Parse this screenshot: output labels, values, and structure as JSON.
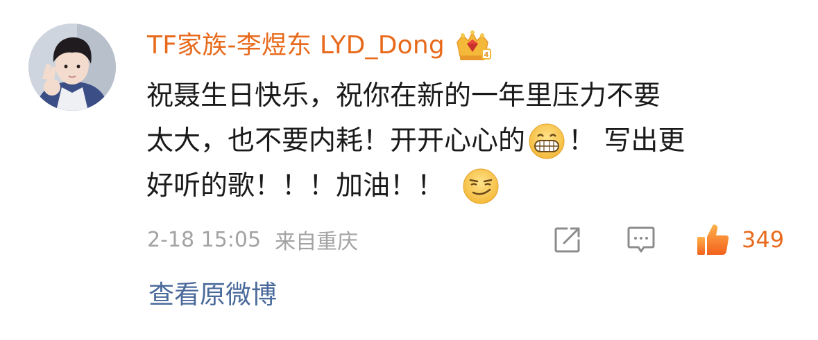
{
  "comment": {
    "username": "TF家族-李煜东 LYD_Dong",
    "badge_icon": "crown-badge-icon",
    "lines": [
      {
        "before": "祝聂生日快乐，祝你在新的一年里压力不要",
        "after": ""
      },
      {
        "before": "太大，也不要内耗！开开心心的",
        "after": "！ 写出更"
      },
      {
        "before": "好听的歌！！！加油！！",
        "after": ""
      }
    ],
    "emojis": {
      "grin": "grin-emoji",
      "smirk": "smirk-emoji"
    },
    "timestamp": "2-18 15:05",
    "location": "来自重庆",
    "like_count": "349",
    "view_original_label": "查看原微博"
  },
  "colors": {
    "username": "#e86a1c",
    "text": "#1a1a1a",
    "meta": "#a3a3a3",
    "link": "#4a6a9b",
    "like": "#e86a1c"
  }
}
